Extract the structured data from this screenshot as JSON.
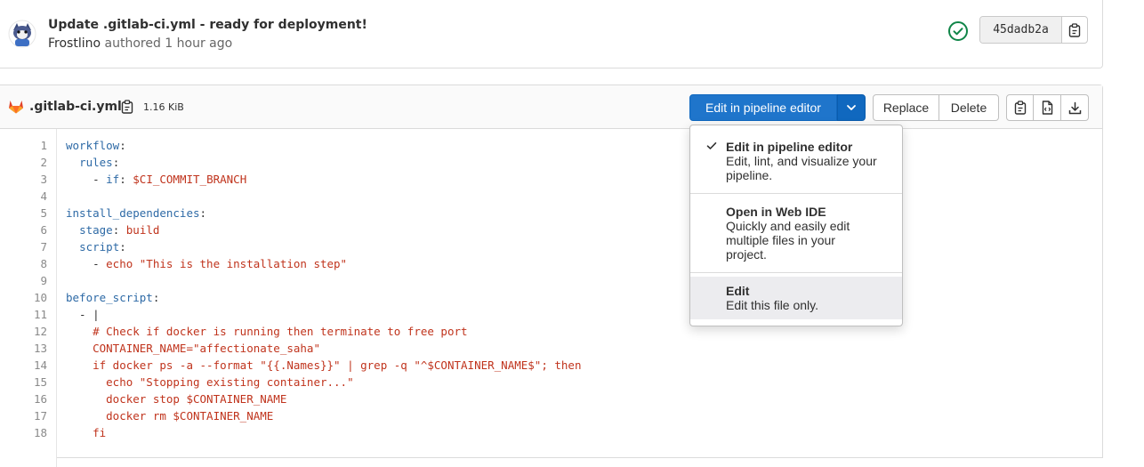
{
  "commit": {
    "title": "Update .gitlab-ci.yml - ready for deployment!",
    "author": "Frostlino",
    "authored_text": "authored",
    "time": "1 hour ago",
    "sha": "45dadb2a",
    "status_icon": "check-circle-icon",
    "colors": {
      "status": "#108548"
    }
  },
  "file": {
    "name": ".gitlab-ci.yml",
    "size": "1.16 KiB",
    "buttons": {
      "edit_pipeline": "Edit in pipeline editor",
      "replace": "Replace",
      "delete": "Delete"
    },
    "colors": {
      "primary": "#1f75cb"
    }
  },
  "dropdown": {
    "items": [
      {
        "title": "Edit in pipeline editor",
        "description": "Edit, lint, and visualize your pipeline.",
        "checked": true
      },
      {
        "title": "Open in Web IDE",
        "description": "Quickly and easily edit multiple files in your project.",
        "checked": false
      },
      {
        "title": "Edit",
        "description": "Edit this file only.",
        "checked": false
      }
    ]
  },
  "code": {
    "lines": [
      {
        "n": "1",
        "parts": [
          [
            "k",
            "workflow"
          ],
          [
            "p",
            ":"
          ]
        ]
      },
      {
        "n": "2",
        "parts": [
          [
            "p",
            "  "
          ],
          [
            "k",
            "rules"
          ],
          [
            "p",
            ":"
          ]
        ]
      },
      {
        "n": "3",
        "parts": [
          [
            "p",
            "    - "
          ],
          [
            "k",
            "if"
          ],
          [
            "p",
            ": "
          ],
          [
            "s",
            "$CI_COMMIT_BRANCH"
          ]
        ]
      },
      {
        "n": "4",
        "parts": []
      },
      {
        "n": "5",
        "parts": [
          [
            "k",
            "install_dependencies"
          ],
          [
            "p",
            ":"
          ]
        ]
      },
      {
        "n": "6",
        "parts": [
          [
            "p",
            "  "
          ],
          [
            "k",
            "stage"
          ],
          [
            "p",
            ": "
          ],
          [
            "s",
            "build"
          ]
        ]
      },
      {
        "n": "7",
        "parts": [
          [
            "p",
            "  "
          ],
          [
            "k",
            "script"
          ],
          [
            "p",
            ":"
          ]
        ]
      },
      {
        "n": "8",
        "parts": [
          [
            "p",
            "    - "
          ],
          [
            "s",
            "echo \"This is the installation step\""
          ]
        ]
      },
      {
        "n": "9",
        "parts": []
      },
      {
        "n": "10",
        "parts": [
          [
            "k",
            "before_script"
          ],
          [
            "p",
            ":"
          ]
        ]
      },
      {
        "n": "11",
        "parts": [
          [
            "p",
            "  - |"
          ]
        ]
      },
      {
        "n": "12",
        "parts": [
          [
            "s",
            "    # Check if docker is running then terminate to free port"
          ]
        ]
      },
      {
        "n": "13",
        "parts": [
          [
            "s",
            "    CONTAINER_NAME=\"affectionate_saha\""
          ]
        ]
      },
      {
        "n": "14",
        "parts": [
          [
            "s",
            "    if docker ps -a --format \"{{.Names}}\" | grep -q \"^$CONTAINER_NAME$\"; then"
          ]
        ]
      },
      {
        "n": "15",
        "parts": [
          [
            "s",
            "      echo \"Stopping existing container...\""
          ]
        ]
      },
      {
        "n": "16",
        "parts": [
          [
            "s",
            "      docker stop $CONTAINER_NAME"
          ]
        ]
      },
      {
        "n": "17",
        "parts": [
          [
            "s",
            "      docker rm $CONTAINER_NAME"
          ]
        ]
      },
      {
        "n": "18",
        "parts": [
          [
            "s",
            "    fi"
          ]
        ]
      }
    ]
  }
}
